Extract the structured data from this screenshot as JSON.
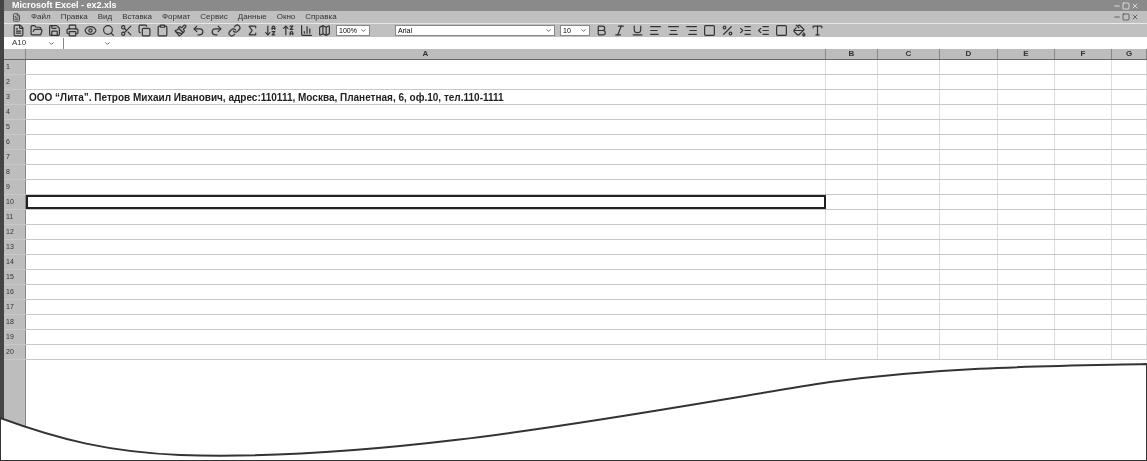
{
  "window": {
    "title": "Microsoft Excel - ex2.xls"
  },
  "menu": [
    "Файл",
    "Правка",
    "Вид",
    "Вставка",
    "Формат",
    "Сервис",
    "Данные",
    "Окно",
    "Справка"
  ],
  "toolbar": {
    "zoom": "100%",
    "font": "Arial",
    "font_size": "10"
  },
  "formula_bar": {
    "name_box": "A10"
  },
  "columns": [
    {
      "label": "A"
    },
    {
      "label": "B"
    },
    {
      "label": "C"
    },
    {
      "label": "D"
    },
    {
      "label": "E"
    },
    {
      "label": "F"
    },
    {
      "label": "G"
    }
  ],
  "rows": [
    {
      "label": "1",
      "active": false
    },
    {
      "label": "2",
      "active": false
    },
    {
      "label": "3",
      "active": false,
      "cell_a": "ООО “Лита”. Петров Михаил Иванович, адрес:110111, Москва, Планетная, 6, оф.10, тел.110-1111"
    },
    {
      "label": "4",
      "active": false
    },
    {
      "label": "5",
      "active": false
    },
    {
      "label": "6",
      "active": false
    },
    {
      "label": "7",
      "active": false
    },
    {
      "label": "8",
      "active": false
    },
    {
      "label": "9",
      "active": false
    },
    {
      "label": "10",
      "active": true
    },
    {
      "label": "11",
      "active": false
    },
    {
      "label": "12",
      "active": false
    },
    {
      "label": "13",
      "active": false
    },
    {
      "label": "14",
      "active": false
    },
    {
      "label": "15",
      "active": false
    },
    {
      "label": "16",
      "active": false
    },
    {
      "label": "17",
      "active": false
    },
    {
      "label": "18",
      "active": false
    },
    {
      "label": "19",
      "active": false
    },
    {
      "label": "20",
      "active": false
    }
  ]
}
